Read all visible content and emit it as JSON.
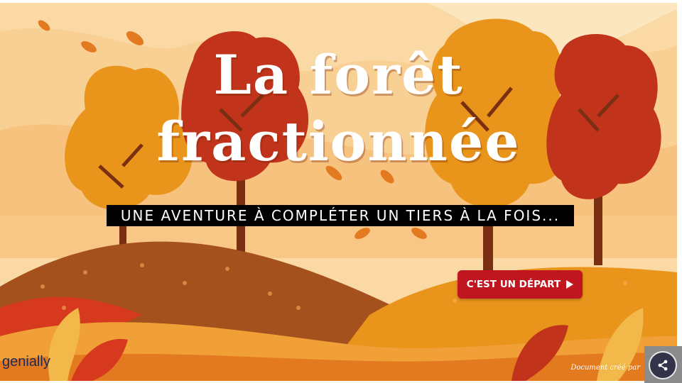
{
  "presentation": {
    "title_line1": "La forêt",
    "title_line2": "fractionnée",
    "subtitle": "UNE AVENTURE À COMPLÉTER UN TIERS À LA FOIS...",
    "start_button_label": "C'EST UN DÉPART",
    "start_button_icon": "play-triangle-icon"
  },
  "footer": {
    "brand_logo": "genially",
    "credit_text": "Document créé par",
    "share_icon": "share-icon"
  },
  "colors": {
    "background": "#fbd9a4",
    "accent_red": "#c0161f",
    "tree_orange": "#e9951c",
    "tree_red": "#c1331a",
    "hill_brown": "#a4511e"
  }
}
